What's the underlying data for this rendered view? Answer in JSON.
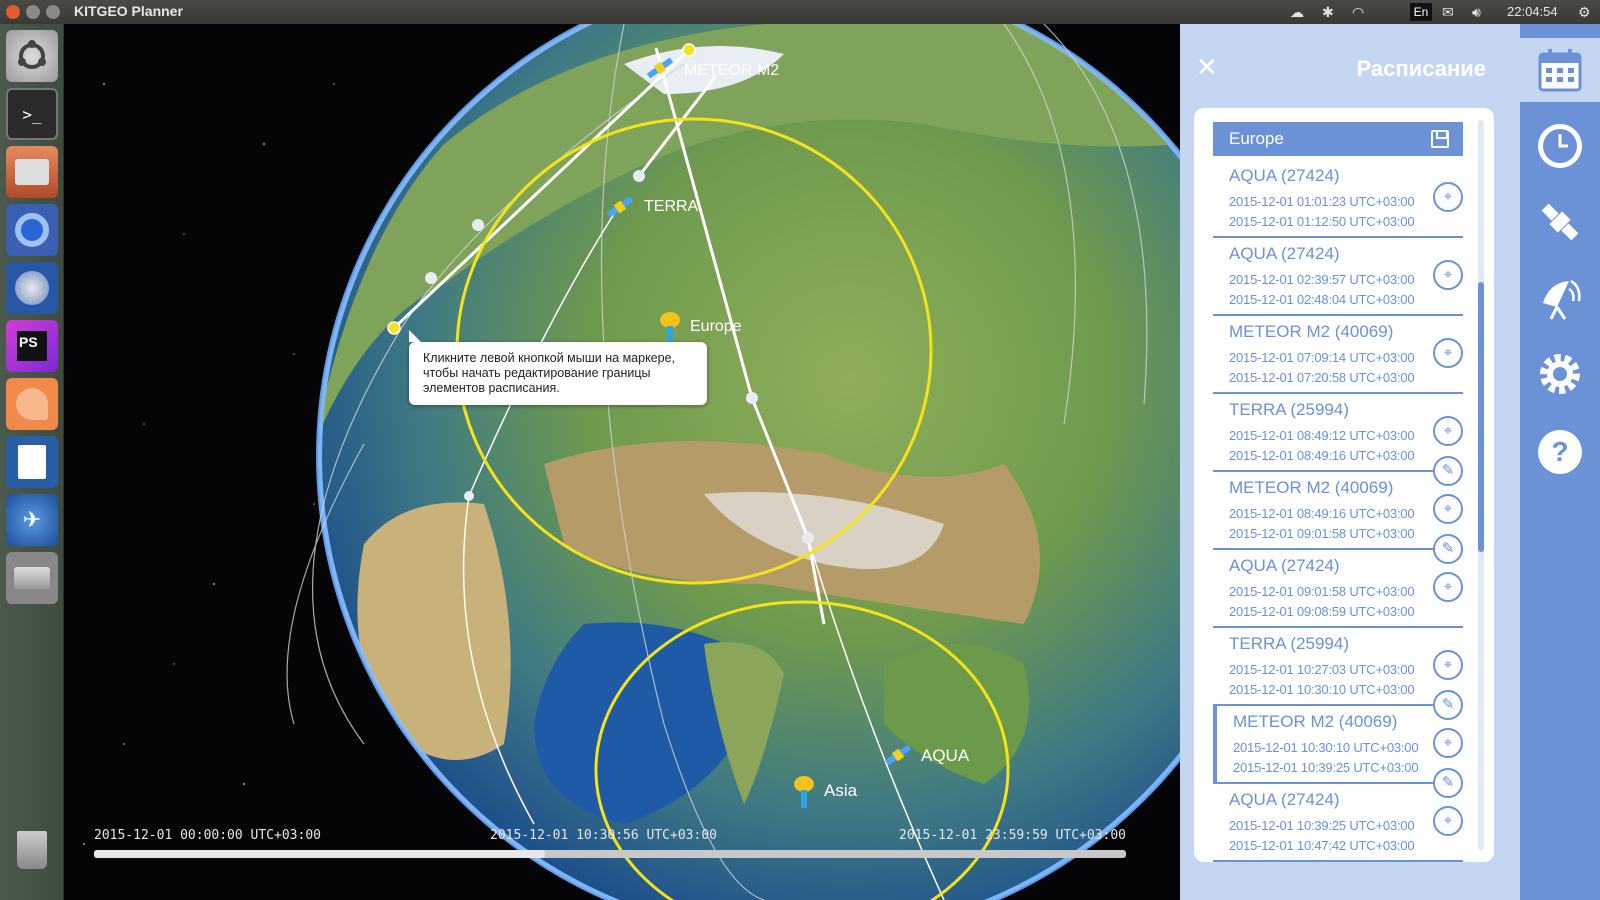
{
  "window": {
    "title": "KITGEO Planner",
    "clock": "22:04:54",
    "keyboard_layout": "En"
  },
  "globe": {
    "satellite_labels": [
      "METEOR M2",
      "TERRA",
      "AQUA"
    ],
    "station_labels": [
      "Europe",
      "Asia"
    ],
    "tooltip": "Кликните левой кнопкой мыши на маркере, чтобы начать редактирование границы элементов расписания."
  },
  "timeline": {
    "start": "2015-12-01 00:00:00 UTC+03:00",
    "current": "2015-12-01 10:30:56 UTC+03:00",
    "end": "2015-12-01 23:59:59 UTC+03:00",
    "progress": 0.437
  },
  "schedule": {
    "title": "Расписание",
    "group_name": "Europe",
    "items": [
      {
        "name": "AQUA (27424)",
        "start": "2015-12-01 01:01:23 UTC+03:00",
        "end": "2015-12-01 01:12:50 UTC+03:00",
        "editable": false,
        "active": false
      },
      {
        "name": "AQUA (27424)",
        "start": "2015-12-01 02:39:57 UTC+03:00",
        "end": "2015-12-01 02:48:04 UTC+03:00",
        "editable": false,
        "active": false
      },
      {
        "name": "METEOR M2 (40069)",
        "start": "2015-12-01 07:09:14 UTC+03:00",
        "end": "2015-12-01 07:20:58 UTC+03:00",
        "editable": false,
        "active": false
      },
      {
        "name": "TERRA (25994)",
        "start": "2015-12-01 08:49:12 UTC+03:00",
        "end": "2015-12-01 08:49:16 UTC+03:00",
        "editable": true,
        "active": false
      },
      {
        "name": "METEOR M2 (40069)",
        "start": "2015-12-01 08:49:16 UTC+03:00",
        "end": "2015-12-01 09:01:58 UTC+03:00",
        "editable": true,
        "active": false
      },
      {
        "name": "AQUA (27424)",
        "start": "2015-12-01 09:01:58 UTC+03:00",
        "end": "2015-12-01 09:08:59 UTC+03:00",
        "editable": false,
        "active": false
      },
      {
        "name": "TERRA (25994)",
        "start": "2015-12-01 10:27:03 UTC+03:00",
        "end": "2015-12-01 10:30:10 UTC+03:00",
        "editable": true,
        "active": false
      },
      {
        "name": "METEOR M2 (40069)",
        "start": "2015-12-01 10:30:10 UTC+03:00",
        "end": "2015-12-01 10:39:25 UTC+03:00",
        "editable": true,
        "active": true
      },
      {
        "name": "AQUA (27424)",
        "start": "2015-12-01 10:39:25 UTC+03:00",
        "end": "2015-12-01 10:47:42 UTC+03:00",
        "editable": false,
        "active": false
      }
    ]
  },
  "sidebar_icons": [
    "calendar-icon",
    "clock-icon",
    "satellite-icon",
    "antenna-icon",
    "settings-icon",
    "help-icon"
  ],
  "launcher_icons": [
    "ubuntu-dash-icon",
    "terminal-icon",
    "file-manager-icon",
    "chromium-icon",
    "thunderbird-icon",
    "phpstorm-icon",
    "sublime-icon",
    "writer-icon",
    "kitgeo-icon",
    "drive-icon",
    "trash-icon"
  ],
  "colors": {
    "accent": "#6b91d6",
    "panel_bg": "#c5d6f3",
    "zone": "#f4e21a"
  }
}
